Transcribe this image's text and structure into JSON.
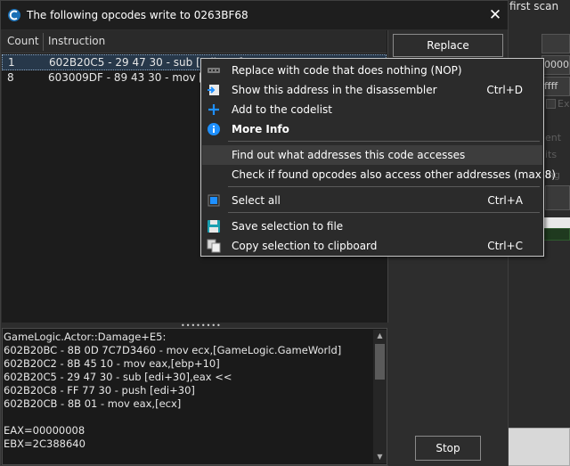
{
  "background_window": {
    "title_partial": "first scan",
    "hex_partial_1": "0000",
    "hex_partial_2": "ffff",
    "label_ex": "Ex",
    "label_ent": "ent",
    "label_its": "its",
    "label_ing": "ing"
  },
  "dialog": {
    "title": "The following opcodes write to 0263BF68",
    "columns": {
      "count": "Count",
      "instruction": "Instruction"
    },
    "rows": [
      {
        "count": "1",
        "instruction": "602B20C5 - 29 47 30  - sub [edi+30],eax",
        "selected": true
      },
      {
        "count": "8",
        "instruction": "603009DF - 89 43 30  - mov [ebx+30],eax",
        "selected": false
      }
    ],
    "buttons": {
      "replace": "Replace",
      "stop": "Stop"
    },
    "splitter_grip": "••••••••",
    "detail_lines": [
      "GameLogic.Actor::Damage+E5:",
      "602B20BC - 8B 0D 7C7D3460  - mov ecx,[GameLogic.GameWorld]",
      "602B20C2 - 8B 45 10  - mov eax,[ebp+10]",
      "602B20C5 - 29 47 30  - sub [edi+30],eax <<",
      "602B20C8 - FF 77 30  - push [edi+30]",
      "602B20CB - 8B 01  - mov eax,[ecx]",
      "",
      "EAX=00000008",
      "EBX=2C388640"
    ]
  },
  "context_menu": {
    "items": [
      {
        "label": "Replace with code that does nothing (NOP)",
        "shortcut": "",
        "icon": "nop-icon"
      },
      {
        "label": "Show this address in the disassembler",
        "shortcut": "Ctrl+D",
        "icon": "disassembler-icon"
      },
      {
        "label": "Add to the codelist",
        "shortcut": "",
        "icon": "plus-icon"
      },
      {
        "label": "More Info",
        "shortcut": "",
        "icon": "info-icon"
      },
      {
        "label": "Find out what addresses this code accesses",
        "shortcut": "",
        "icon": ""
      },
      {
        "label": "Check if found opcodes also access other addresses (max 8)",
        "shortcut": "",
        "icon": ""
      },
      {
        "label": "Select all",
        "shortcut": "Ctrl+A",
        "icon": "select-all-icon"
      },
      {
        "label": "Save selection to file",
        "shortcut": "",
        "icon": "save-icon"
      },
      {
        "label": "Copy selection to clipboard",
        "shortcut": "Ctrl+C",
        "icon": "copy-icon"
      }
    ]
  },
  "colors": {
    "accent_blue": "#1e90ff",
    "selection": "#27384a",
    "menu_hover": "#3d3d3d"
  }
}
